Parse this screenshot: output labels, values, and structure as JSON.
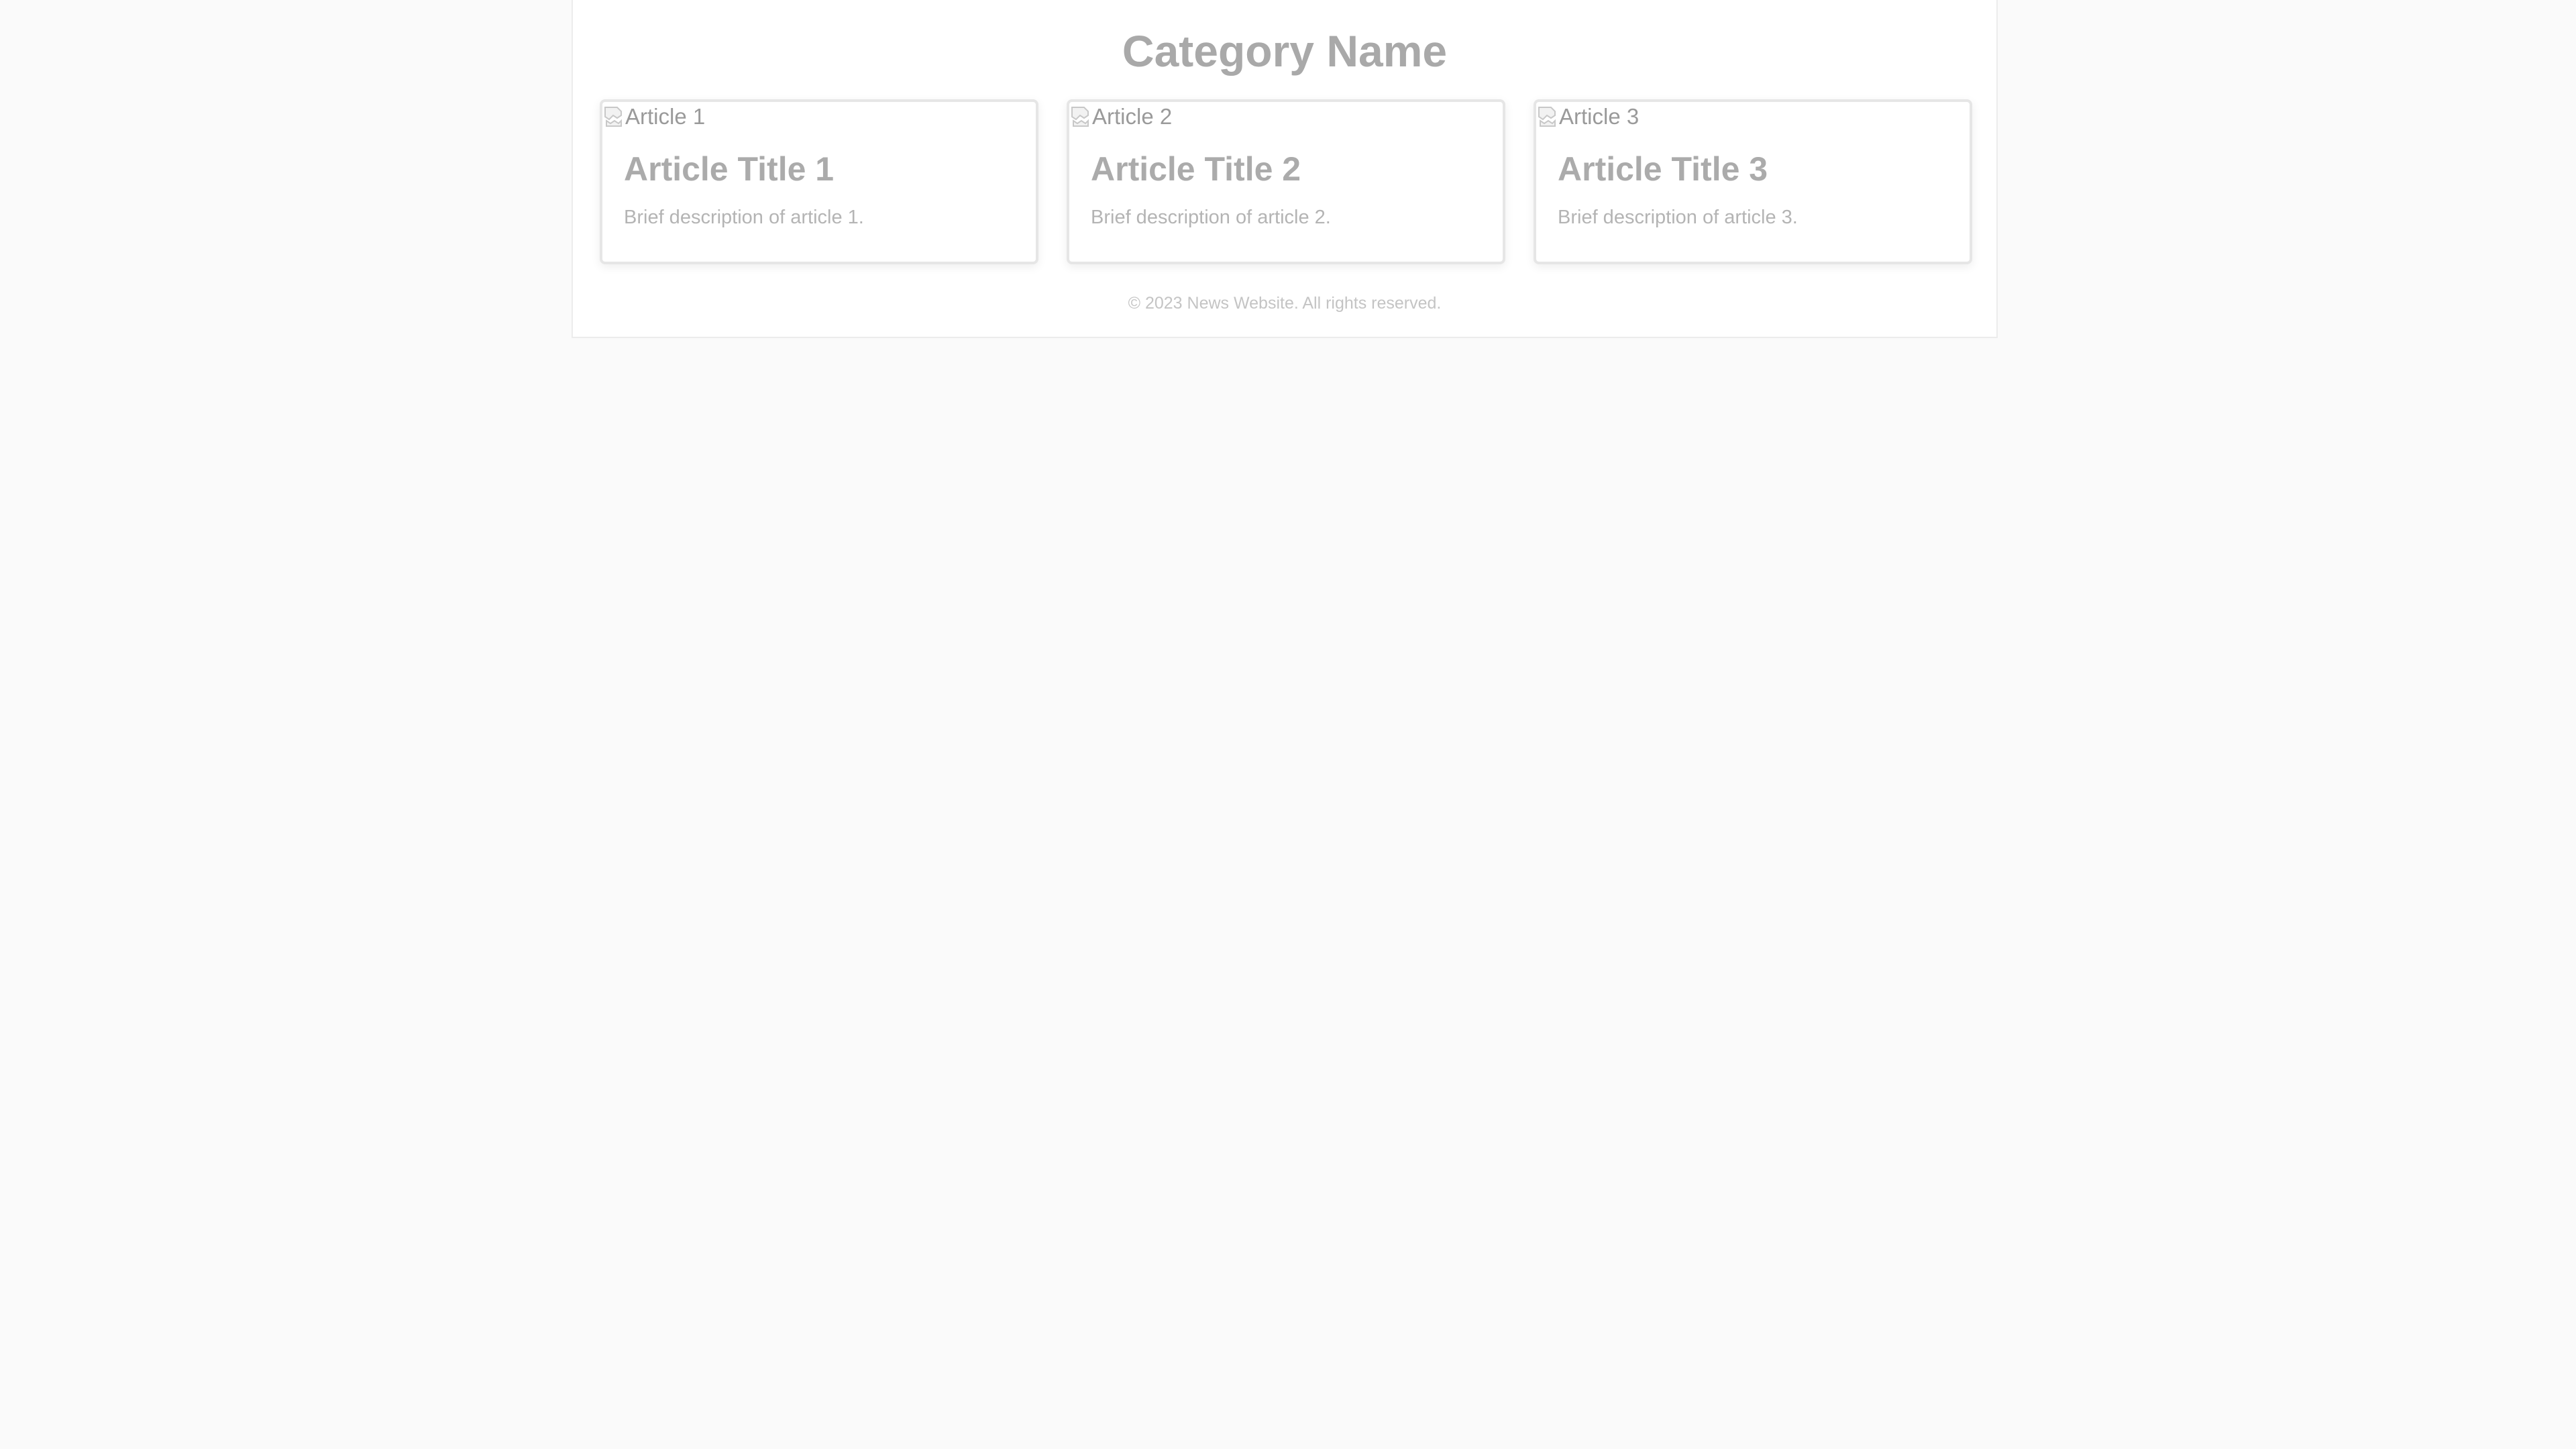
{
  "category": {
    "title": "Category Name"
  },
  "articles": [
    {
      "image_alt": "Article 1",
      "title": "Article Title 1",
      "description": "Brief description of article 1."
    },
    {
      "image_alt": "Article 2",
      "title": "Article Title 2",
      "description": "Brief description of article 2."
    },
    {
      "image_alt": "Article 3",
      "title": "Article Title 3",
      "description": "Brief description of article 3."
    }
  ],
  "footer": {
    "copyright": "© 2023 News Website. All rights reserved."
  },
  "colors": {
    "page_background": "#fafafa",
    "content_background": "#ffffff",
    "heading_text": "#a9a9a9",
    "muted_text": "#b4b4b4"
  },
  "icons": {
    "broken_image": "broken-image-icon"
  }
}
